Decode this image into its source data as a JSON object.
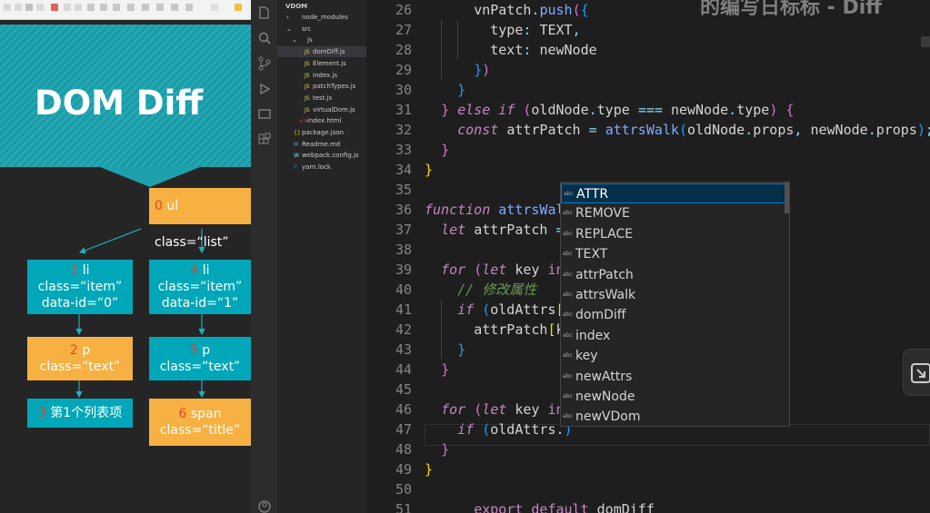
{
  "slide": {
    "title": "DOM Diff",
    "nodes": {
      "root": {
        "num": "0",
        "text": "ul class=“list”"
      },
      "li1": {
        "num": "1",
        "line1": " li",
        "line2": "class=“item”",
        "line3": "data-id=“0”"
      },
      "li4": {
        "num": "4",
        "line1": " li",
        "line2": "class=“item”",
        "line3": "data-id=“1”"
      },
      "p2": {
        "num": "2",
        "line1": " p",
        "line2": "class=“text”"
      },
      "p5": {
        "num": "5",
        "line1": " p",
        "line2": "class=“text”"
      },
      "t3": {
        "num": "3",
        "text": " 第1个列表项"
      },
      "span6": {
        "num": "6",
        "line1": " span",
        "line2": "class=“title”"
      }
    },
    "colors": {
      "teal": "#00a7b8",
      "orange": "#f6b142",
      "number": "#e8432a"
    }
  },
  "explorer": {
    "title": "VDOM",
    "items": [
      {
        "label": "node_modules",
        "caret": "›",
        "icon": ""
      },
      {
        "label": "src",
        "caret": "⌄",
        "icon": ""
      },
      {
        "label": "js",
        "caret": "⌄",
        "icon": ""
      },
      {
        "label": "domDiff.js",
        "caret": "",
        "icon": "JS"
      },
      {
        "label": "Element.js",
        "caret": "",
        "icon": "JS"
      },
      {
        "label": "index.js",
        "caret": "",
        "icon": "JS"
      },
      {
        "label": "patchTypes.js",
        "caret": "",
        "icon": "JS"
      },
      {
        "label": "test.js",
        "caret": "",
        "icon": "JS"
      },
      {
        "label": "virtualDom.js",
        "caret": "",
        "icon": "JS"
      },
      {
        "label": "index.html",
        "caret": "",
        "icon": "<>"
      },
      {
        "label": "package.json",
        "caret": "",
        "icon": "{}"
      },
      {
        "label": "Readme.md",
        "caret": "",
        "icon": "M"
      },
      {
        "label": "webpack.config.js",
        "caret": "",
        "icon": "W"
      },
      {
        "label": "yarn.lock",
        "caret": "",
        "icon": "Y"
      }
    ]
  },
  "editor": {
    "line_numbers": [
      "26",
      "27",
      "28",
      "29",
      "30",
      "31",
      "32",
      "33",
      "34",
      "35",
      "36",
      "37",
      "38",
      "39",
      "40",
      "41",
      "42",
      "43",
      "44",
      "45",
      "46",
      "47",
      "48",
      "49",
      "50",
      "51"
    ],
    "watermark": "的编写日标标 - Diff"
  },
  "suggest": {
    "items": [
      "ATTR",
      "REMOVE",
      "REPLACE",
      "TEXT",
      "attrPatch",
      "attrsWalk",
      "domDiff",
      "index",
      "key",
      "newAttrs",
      "newNode",
      "newVDom"
    ],
    "icon_label": "abc",
    "active_index": 0
  },
  "activity": {
    "icons": [
      "files-icon",
      "search-icon",
      "source-control-icon",
      "debug-icon",
      "remote-icon",
      "extensions-icon",
      "account-icon"
    ]
  }
}
